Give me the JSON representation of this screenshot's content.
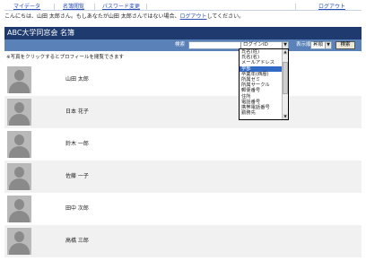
{
  "nav": {
    "mydata": "マイデータ",
    "directory": "名簿閲覧",
    "password": "パスワード変更",
    "logout": "ログアウト"
  },
  "welcome": {
    "text_before": "こんにちは、山田 太郎さん。もしあなたが山田 太郎さんではない場合、",
    "logout_link": "ログアウト",
    "text_after": "してください。"
  },
  "title": "ABC大学同窓会 名簿",
  "search": {
    "label": "検索",
    "query_value": "",
    "field_selected": "ログインID",
    "display_label": "表示順",
    "order_selected": "昇順",
    "button": "検索"
  },
  "dropdown_options": [
    "氏名(姓)",
    "氏名(名)",
    "メールアドレス",
    "学部",
    "卒業年(西暦)",
    "所属ゼミ",
    "所属サークル",
    "郵便番号",
    "住所",
    "電話番号",
    "携帯電話番号",
    "勤務先"
  ],
  "dropdown_selected_index": 3,
  "note": "※写真をクリックするとプロフィールを閲覧できます",
  "members": [
    "山田 太郎",
    "日本 花子",
    "鈴木 一郎",
    "佐藤 一子",
    "田中 次郎",
    "高橋 三郎"
  ]
}
